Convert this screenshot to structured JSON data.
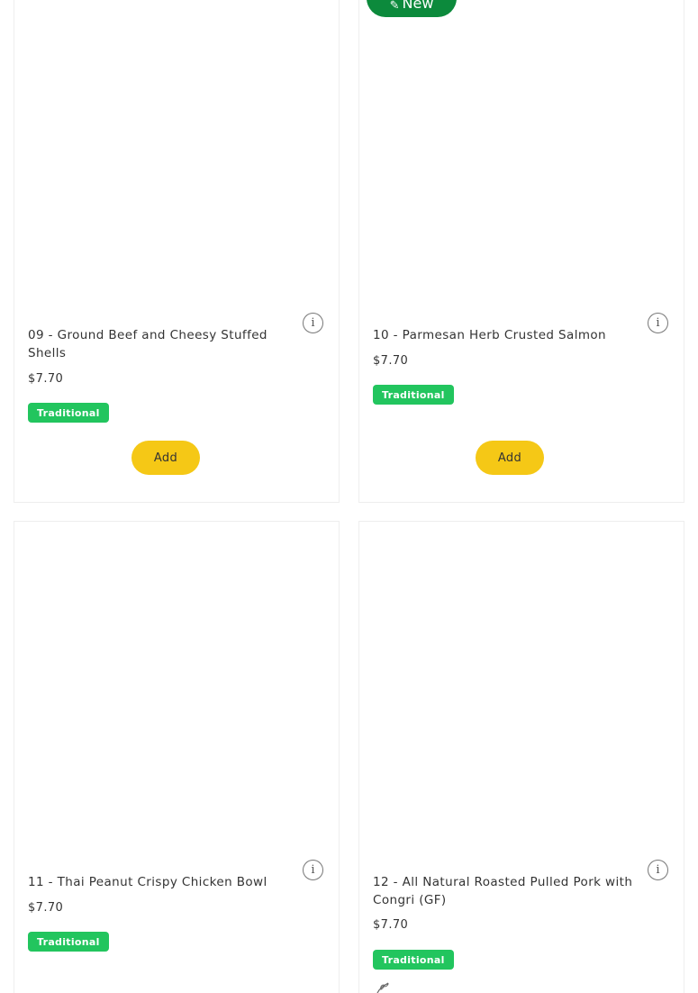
{
  "cards": [
    {
      "title": "09 - Ground Beef and Cheesy Stuffed Shells",
      "price": "$7.70",
      "tag": "Traditional",
      "add_label": "Add",
      "info_glyph": "i"
    },
    {
      "badge": {
        "icon": "✎",
        "label": "New"
      },
      "title": "10 - Parmesan Herb Crusted Salmon",
      "price": "$7.70",
      "tag": "Traditional",
      "add_label": "Add",
      "info_glyph": "i"
    },
    {
      "title": "11 - Thai Peanut Crispy Chicken Bowl",
      "price": "$7.70",
      "tag": "Traditional",
      "info_glyph": "i"
    },
    {
      "title": "12 - All Natural Roasted Pulled Pork with Congri (GF)",
      "price": "$7.70",
      "tag": "Traditional",
      "info_glyph": "i",
      "diet_icon": "leaf-icon"
    }
  ],
  "colors": {
    "tag_green": "#22c55e",
    "new_badge_green": "#0c8a3c",
    "add_button_yellow": "#f5c816",
    "card_border": "#eeeeee"
  }
}
